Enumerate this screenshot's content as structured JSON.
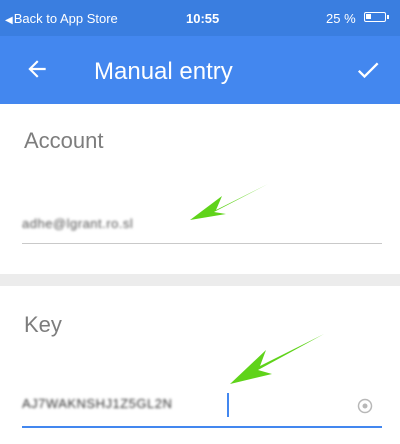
{
  "status_bar": {
    "back_label": "Back to App Store",
    "time": "10:55",
    "battery": "25 %",
    "battery_level": 0.25
  },
  "app_bar": {
    "title": "Manual entry",
    "back_icon": "arrow-left-icon",
    "confirm_icon": "check-icon"
  },
  "fields": {
    "account_label": "Account",
    "account_value": "adhe@lgrant.ro.sl",
    "key_label": "Key",
    "key_value": "AJ7WAKNSHJ1Z5GL2N"
  },
  "colors": {
    "status_bar": "#3a7ee0",
    "app_bar": "#4387ef",
    "accent": "#4387ef",
    "annotation_arrow": "#5fd31a"
  }
}
